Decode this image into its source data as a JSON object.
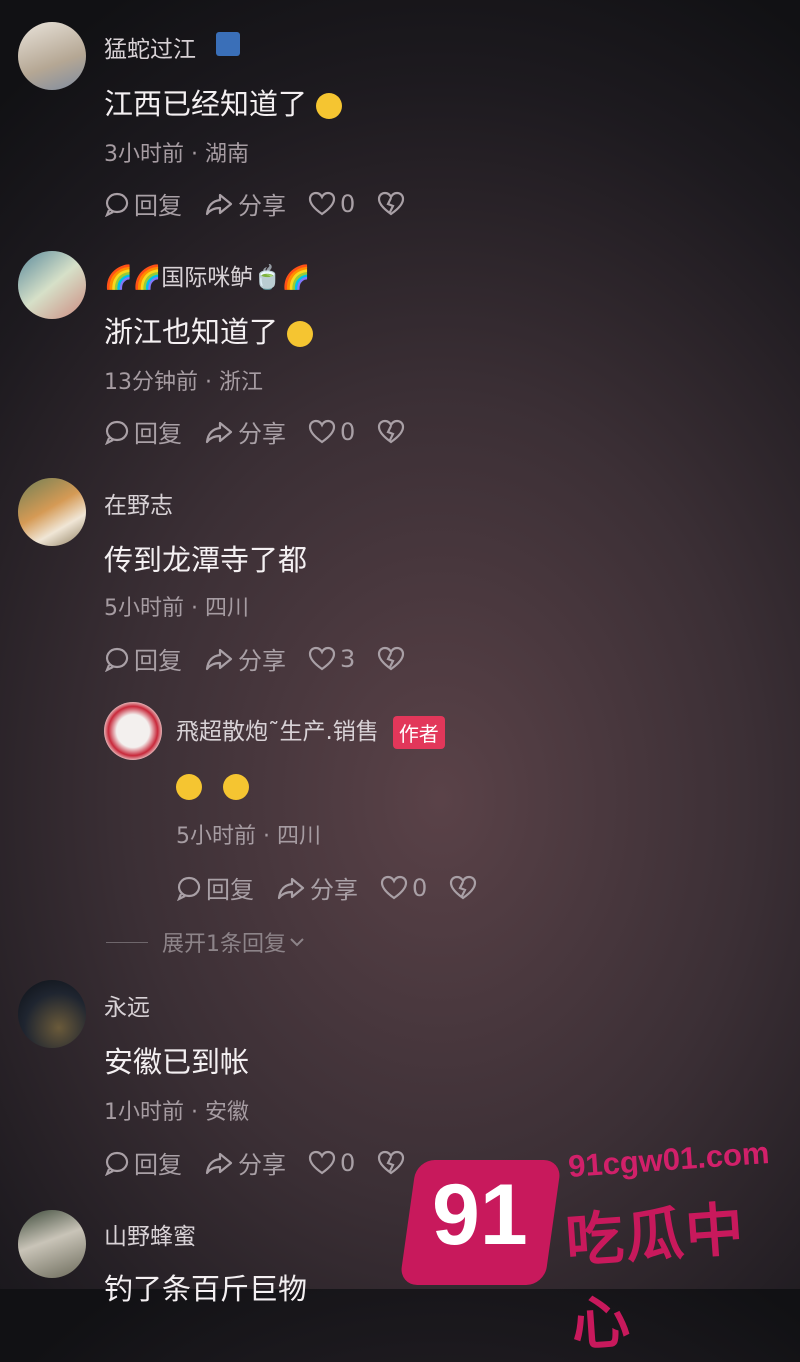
{
  "comments": [
    {
      "name": "猛蛇过江",
      "text": "江西已经知道了",
      "time": "3小时前 · 湖南",
      "reply": "回复",
      "share": "分享",
      "likes": "0"
    },
    {
      "name": "🌈🌈国际咪鲈🍵🌈",
      "text": "浙江也知道了",
      "time": "13分钟前 · 浙江",
      "reply": "回复",
      "share": "分享",
      "likes": "0"
    },
    {
      "name": "在野志",
      "text": "传到龙潭寺了都",
      "time": "5小时前 · 四川",
      "reply": "回复",
      "share": "分享",
      "likes": "3"
    },
    {
      "name": "飛超散炮˜生产.销售",
      "tag": "作者",
      "text": "",
      "time": "5小时前 · 四川",
      "reply": "回复",
      "share": "分享",
      "likes": "0"
    },
    {
      "name": "永远",
      "text": "安徽已到帐",
      "time": "1小时前 · 安徽",
      "reply": "回复",
      "share": "分享",
      "likes": "0"
    },
    {
      "name": "山野蜂蜜",
      "text": "钓了条百斤巨物"
    }
  ],
  "expand_label": "展开1条回复",
  "watermark": {
    "num": "91",
    "url": "91cgw01.com",
    "cn": "吃瓜中心"
  }
}
